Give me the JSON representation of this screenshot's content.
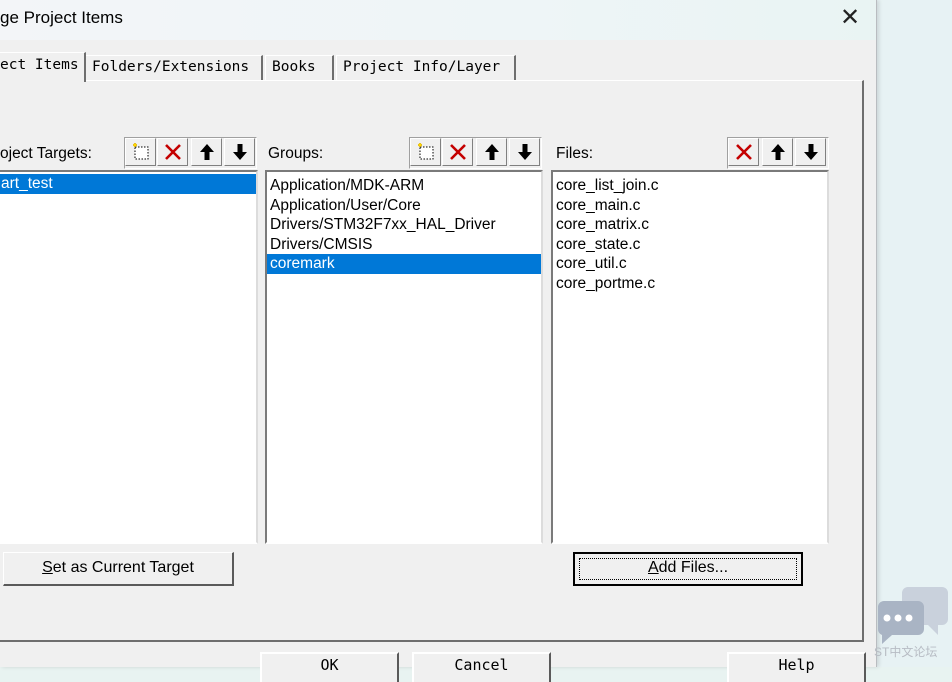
{
  "window": {
    "title": "ge Project Items"
  },
  "tabs": [
    {
      "label": "ect Items",
      "active": true
    },
    {
      "label": "Folders/Extensions",
      "active": false
    },
    {
      "label": "Books",
      "active": false
    },
    {
      "label": "Project Info/Layer",
      "active": false
    }
  ],
  "targets": {
    "label": "oject Targets:",
    "items": [
      "art_test"
    ],
    "selected": 0,
    "set_current_button": "et as Current Target",
    "set_current_mnemonic": "S"
  },
  "groups": {
    "label": "Groups:",
    "items": [
      "Application/MDK-ARM",
      "Application/User/Core",
      "Drivers/STM32F7xx_HAL_Driver",
      "Drivers/CMSIS",
      "coremark"
    ],
    "selected": 4
  },
  "files": {
    "label": "Files:",
    "items": [
      "core_list_join.c",
      "core_main.c",
      "core_matrix.c",
      "core_state.c",
      "core_util.c",
      "core_portme.c"
    ],
    "add_button_mnemonic": "A",
    "add_button_rest": "dd Files..."
  },
  "bottom_buttons": [
    "OK",
    "Cancel",
    "Help"
  ],
  "watermark": {
    "text": "ST中文论坛"
  },
  "icons": {
    "new": "new-item-icon",
    "delete": "delete-icon",
    "up": "move-up-icon",
    "down": "move-down-icon",
    "close": "close-icon"
  },
  "colors": {
    "selection": "#0078d7",
    "delete_red": "#c40000",
    "dialog_bg": "#f0f0f0"
  }
}
